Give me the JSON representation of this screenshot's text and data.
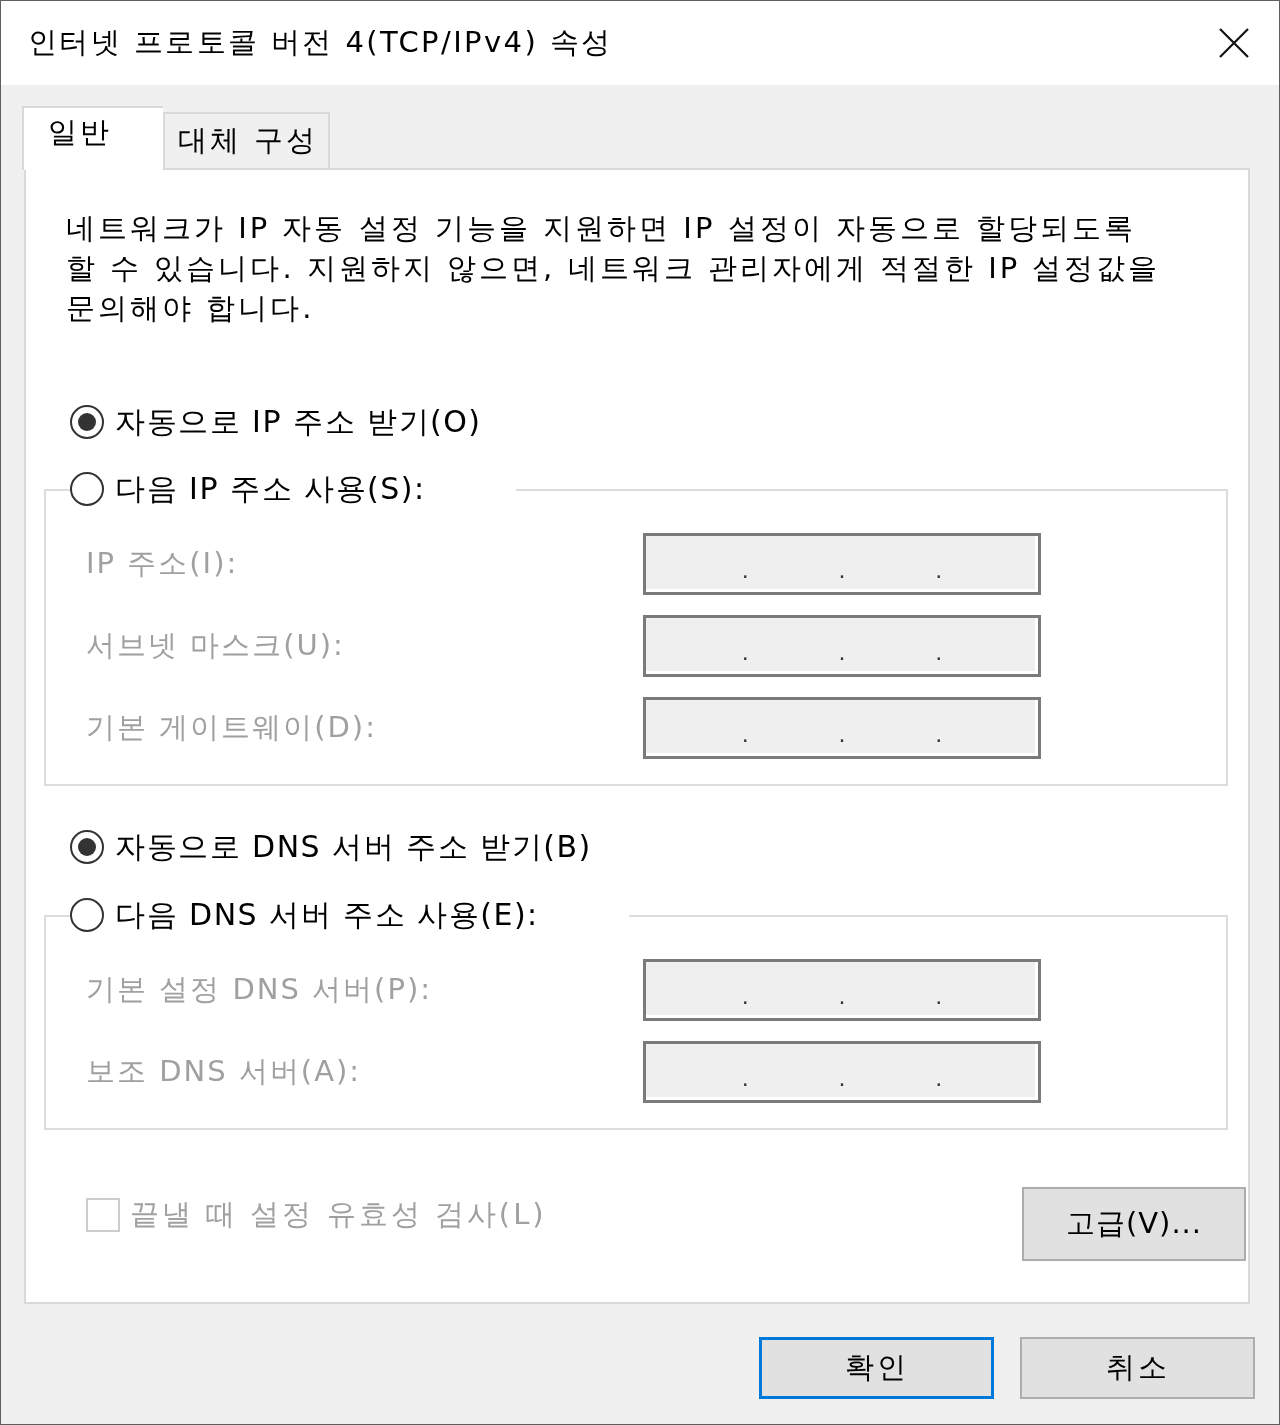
{
  "window": {
    "title": "인터넷 프로토콜 버전 4(TCP/IPv4) 속성"
  },
  "tabs": [
    {
      "label": "일반",
      "selected": true
    },
    {
      "label": "대체 구성",
      "selected": false
    }
  ],
  "description": "네트워크가 IP 자동 설정 기능을 지원하면 IP 설정이 자동으로 할당되도록 할 수 있습니다. 지원하지 않으면, 네트워크 관리자에게 적절한 IP 설정값을 문의해야 합니다.",
  "ip_section": {
    "options": [
      {
        "label": "자동으로 IP 주소 받기(O)",
        "selected": true
      },
      {
        "label": "다음 IP 주소 사용(S):",
        "selected": false
      }
    ],
    "fields": [
      {
        "label": "IP 주소(I):",
        "disabled": true,
        "separators": [
          ".",
          ".",
          "."
        ]
      },
      {
        "label": "서브넷 마스크(U):",
        "disabled": true,
        "separators": [
          ".",
          ".",
          "."
        ]
      },
      {
        "label": "기본 게이트웨이(D):",
        "disabled": true,
        "separators": [
          ".",
          ".",
          "."
        ]
      }
    ]
  },
  "dns_section": {
    "options": [
      {
        "label": "자동으로 DNS 서버 주소 받기(B)",
        "selected": true
      },
      {
        "label": "다음 DNS 서버 주소 사용(E):",
        "selected": false
      }
    ],
    "fields": [
      {
        "label": "기본 설정 DNS 서버(P):",
        "disabled": true,
        "separators": [
          ".",
          ".",
          "."
        ]
      },
      {
        "label": "보조 DNS 서버(A):",
        "disabled": true,
        "separators": [
          ".",
          ".",
          "."
        ]
      }
    ]
  },
  "validate_checkbox": {
    "label": "끝낼 때 설정 유효성 검사(L)",
    "checked": false,
    "disabled": true
  },
  "advanced_button": {
    "label": "고급(V)..."
  },
  "buttons": [
    {
      "label": "확인",
      "default": true
    },
    {
      "label": "취소",
      "default": false
    }
  ]
}
